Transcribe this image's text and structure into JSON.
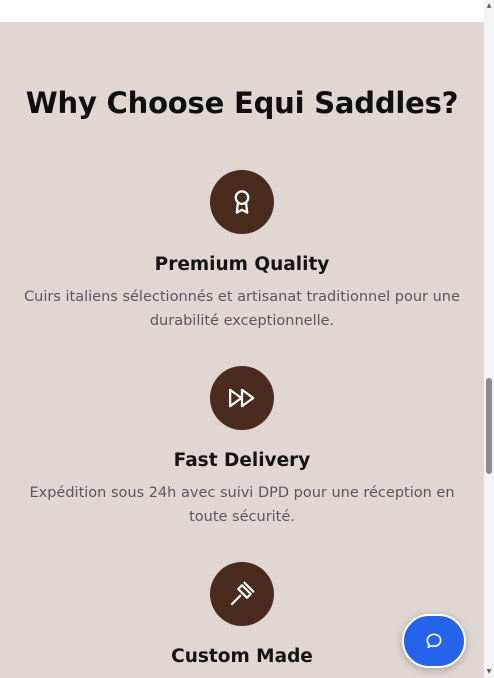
{
  "section": {
    "heading": "Why Choose Equi Saddles?",
    "background": "#e0d6d2",
    "icon_background": "#4a2c1f"
  },
  "features": [
    {
      "icon": "award-ribbon-icon",
      "title": "Premium Quality",
      "description": "Cuirs italiens sélectionnés et artisanat traditionnel pour une durabilité exceptionnelle."
    },
    {
      "icon": "fast-forward-icon",
      "title": "Fast Delivery",
      "description": "Expédition sous 24h avec suivi DPD pour une réception en toute sécurité."
    },
    {
      "icon": "hammer-icon",
      "title": "Custom Made",
      "description": ""
    }
  ],
  "chat": {
    "icon": "chat-bubble-icon",
    "color": "#2563eb"
  }
}
